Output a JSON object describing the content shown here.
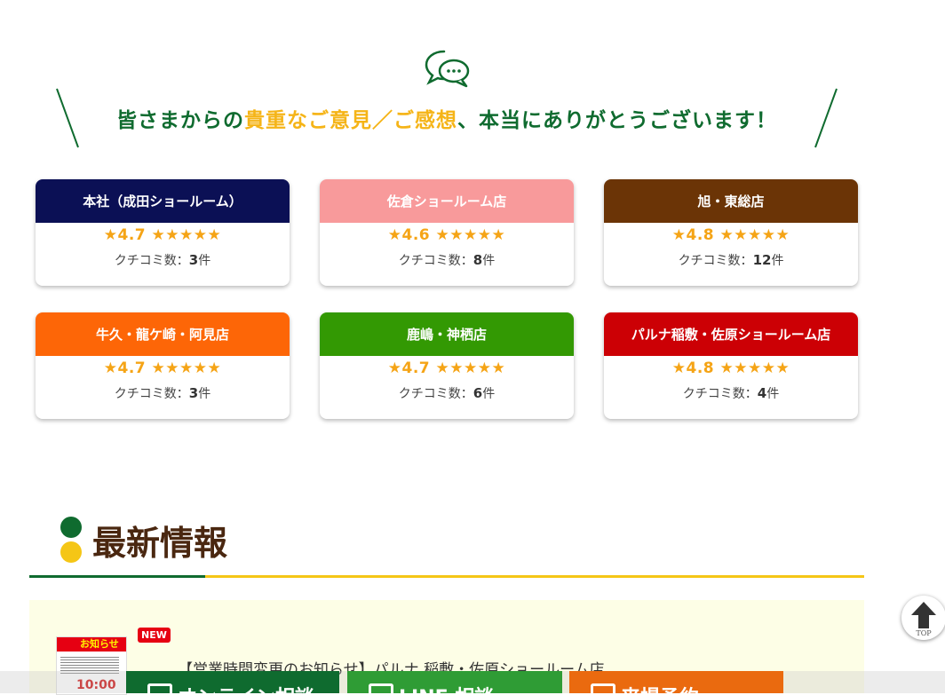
{
  "headline": {
    "part1": "皆さまからの",
    "part2": "貴重なご意見／ご感想",
    "part3": "、本当にありがとうございます！"
  },
  "colors": {
    "green": "#0f6b2f",
    "yellow": "#f5b417",
    "star": "#f5a416"
  },
  "review_label": "クチコミ数：",
  "review_unit": "件",
  "stores": [
    {
      "name": "本社（成田ショールーム）",
      "rating": "★4.7 ★★★★★",
      "count": "3",
      "color": "#0b1055"
    },
    {
      "name": "佐倉ショールーム店",
      "rating": "★4.6 ★★★★★",
      "count": "8",
      "color": "#f89a9b"
    },
    {
      "name": "旭・東総店",
      "rating": "★4.8 ★★★★★",
      "count": "12",
      "color": "#6b3406"
    },
    {
      "name": "牛久・龍ケ崎・阿見店",
      "rating": "★4.7 ★★★★★",
      "count": "3",
      "color": "#fd6607"
    },
    {
      "name": "鹿嶋・神栖店",
      "rating": "★4.7 ★★★★★",
      "count": "6",
      "color": "#339903"
    },
    {
      "name": "パルナ稲敷・佐原ショールーム店",
      "rating": "★4.8 ★★★★★",
      "count": "4",
      "color": "#cc0005"
    }
  ],
  "news": {
    "section_title": "最新情報",
    "badge": "NEW",
    "thumb_label": "お知らせ",
    "thumb_time": "10:00",
    "item_title": "【営業時間変更のお知らせ】パルナ 稲敷・佐原ショールーム店"
  },
  "bottom_buttons": {
    "online": "オンライン相談",
    "line": "LINE 相談",
    "visit": "来場予約"
  },
  "top_button": {
    "label": "TOP",
    "icon": "arrow-up-icon"
  }
}
